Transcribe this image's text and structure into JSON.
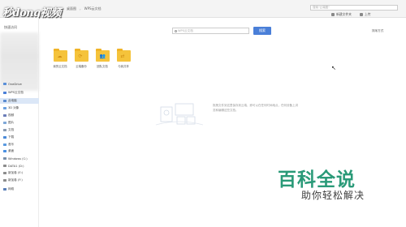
{
  "watermark": {
    "logo_text": "秒dong视频"
  },
  "breadcrumb": {
    "items": [
      "桌面图",
      "WPS云文档"
    ]
  },
  "top_search": {
    "placeholder": "搜索\"云端图\""
  },
  "top_actions": {
    "new_folder": "新建文件夹",
    "more": "上传"
  },
  "sidebar": {
    "pin_label": "快速访问",
    "items": [
      {
        "label": "OneDrive",
        "color": "#5a8fd8"
      },
      {
        "label": "WPS云文档",
        "color": "#4a7fd8"
      },
      {
        "label": "此电脑",
        "color": "#5b8bd0",
        "selected": true
      },
      {
        "label": "3D 对象",
        "color": "#6aa0e0"
      },
      {
        "label": "视频",
        "color": "#6b7db8"
      },
      {
        "label": "图片",
        "color": "#7fa8d8"
      },
      {
        "label": "文档",
        "color": "#8a9ab0"
      },
      {
        "label": "下载",
        "color": "#4a8ad8"
      },
      {
        "label": "音乐",
        "color": "#5a9ae0"
      },
      {
        "label": "桌面",
        "color": "#4a90e2"
      },
      {
        "label": "Windows (C:)",
        "color": "#7a8fa8"
      },
      {
        "label": "DATA1 (D:)",
        "color": "#8c8c8c"
      },
      {
        "label": "新加卷 (E:)",
        "color": "#8c8c8c"
      },
      {
        "label": "新加卷 (F:)",
        "color": "#8c8c8c"
      },
      {
        "label": "网络",
        "color": "#5a7fb8"
      }
    ]
  },
  "main": {
    "search_placeholder": "WPS云文档",
    "search_button": "搜索",
    "sort_label": "排序方式",
    "folders": [
      {
        "label": "我的云文档"
      },
      {
        "label": "云端备份"
      },
      {
        "label": "团队文档"
      },
      {
        "label": "与我共享"
      }
    ],
    "empty_text": "拖拽文件到这里保存到云端，即可以在任何时间地点，任何设备上浏览和编辑这些文档。"
  },
  "brand": {
    "title": "百科全说",
    "subtitle": "助你轻松解决"
  },
  "colors": {
    "accent": "#4a7fd8",
    "folder": "#f5c33b",
    "brand_green": "#2a9a78"
  }
}
